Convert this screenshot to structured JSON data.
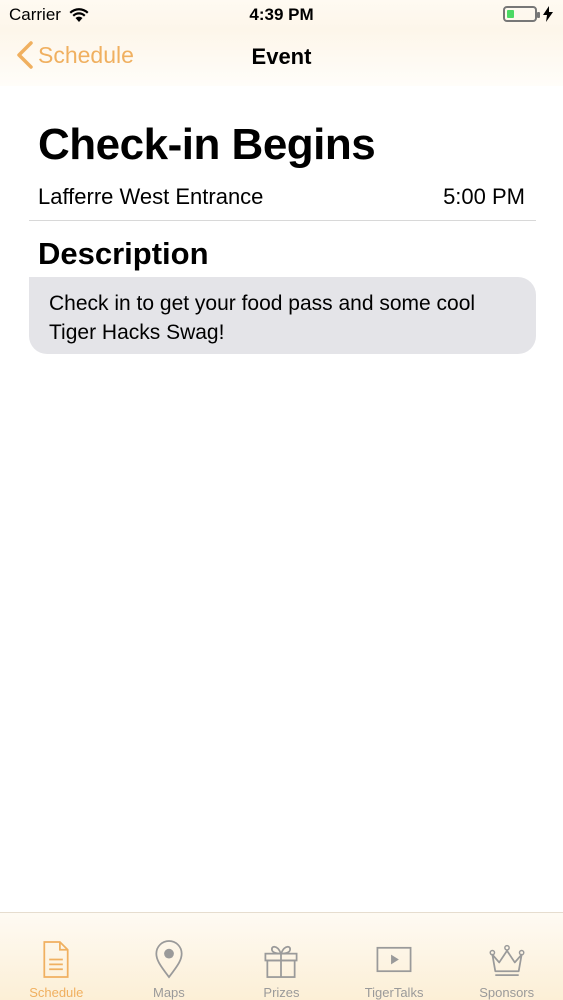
{
  "status": {
    "carrier": "Carrier",
    "time": "4:39 PM",
    "battery_level": 0.25
  },
  "nav": {
    "back_label": "Schedule",
    "title": "Event"
  },
  "event": {
    "title": "Check-in Begins",
    "location": "Lafferre West Entrance",
    "time": "5:00 PM",
    "description_heading": "Description",
    "description": "Check in to get your food pass and some cool Tiger Hacks Swag!"
  },
  "tabs": [
    {
      "label": "Schedule",
      "icon": "document-icon",
      "active": true
    },
    {
      "label": "Maps",
      "icon": "map-pin-icon",
      "active": false
    },
    {
      "label": "Prizes",
      "icon": "gift-icon",
      "active": false
    },
    {
      "label": "TigerTalks",
      "icon": "play-icon",
      "active": false
    },
    {
      "label": "Sponsors",
      "icon": "crown-icon",
      "active": false
    }
  ],
  "colors": {
    "accent": "#f0b060",
    "inactive": "#9a9a9a",
    "bubble": "#e4e4e8",
    "battery": "#4cd964"
  }
}
